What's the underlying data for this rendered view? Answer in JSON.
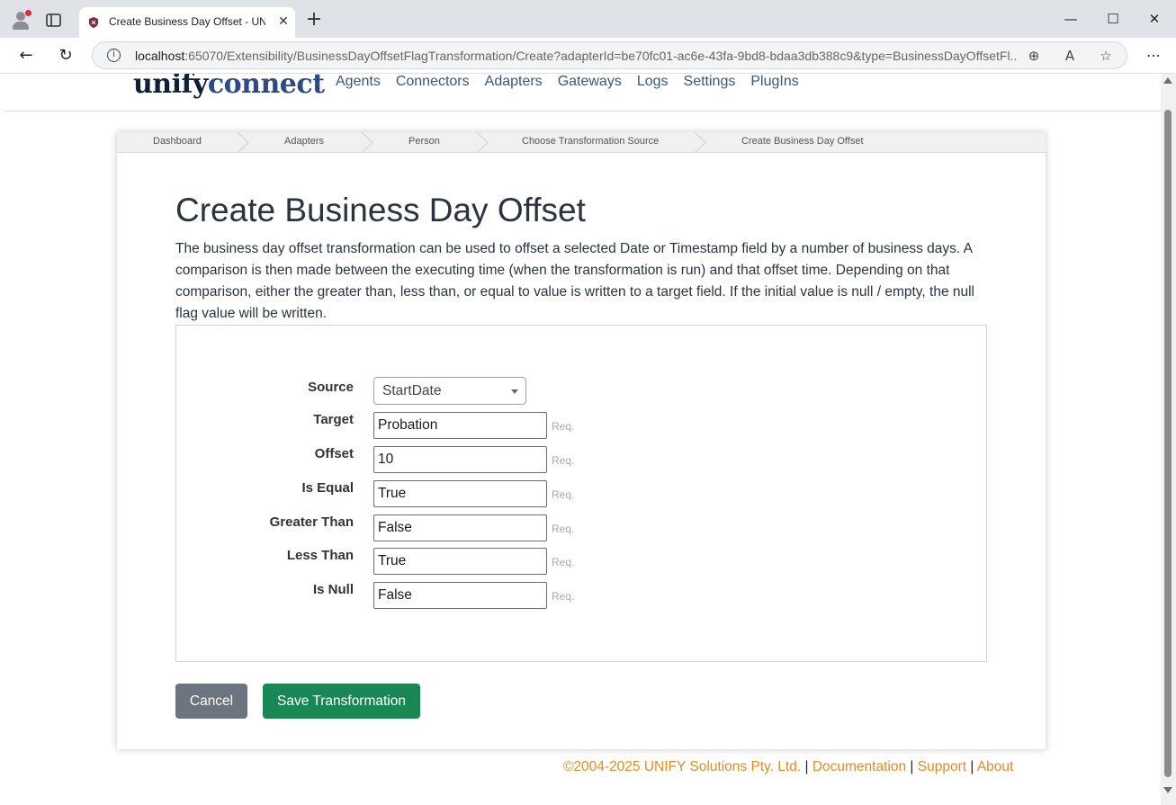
{
  "browser": {
    "tab_title": "Create Business Day Offset - UNIFY",
    "url_host": "localhost",
    "url_rest": ":65070/Extensibility/BusinessDayOffsetFlagTransformation/Create?adapterId=be70fc01-ac6e-43fa-9bd8-bdaa3db388c9&type=BusinessDayOffsetFl...",
    "controls": {
      "minimize": "—",
      "maximize": "☐",
      "close": "✕"
    }
  },
  "brand": {
    "part1": "unify",
    "part2": "connect"
  },
  "nav": {
    "links": [
      "Agents",
      "Connectors",
      "Adapters",
      "Gateways",
      "Logs",
      "Settings",
      "PlugIns"
    ]
  },
  "breadcrumb": {
    "items": [
      "Dashboard",
      "Adapters",
      "Person",
      "Choose Transformation Source",
      "Create Business Day Offset"
    ]
  },
  "page": {
    "title": "Create Business Day Offset",
    "description": "The business day offset transformation can be used to offset a selected Date or Timestamp field by a number of business days. A comparison is then made between the executing time (when the transformation is run) and that offset time. Depending on that comparison, either the greater than, less than, or equal to value is written to a target field. If the initial value is null / empty, the null flag value will be written."
  },
  "form": {
    "source": {
      "label": "Source",
      "value": "StartDate"
    },
    "req_label": "Req.",
    "fields": [
      {
        "label": "Target",
        "value": "Probation"
      },
      {
        "label": "Offset",
        "value": "10"
      },
      {
        "label": "Is Equal",
        "value": "True"
      },
      {
        "label": "Greater Than",
        "value": "False"
      },
      {
        "label": "Less Than",
        "value": "True"
      },
      {
        "label": "Is Null",
        "value": "False"
      }
    ]
  },
  "buttons": {
    "cancel": "Cancel",
    "save": "Save Transformation"
  },
  "footer": {
    "copyright": "©2004-2025 UNIFY Solutions Pty. Ltd.",
    "sep": "|",
    "documentation": "Documentation",
    "support": "Support",
    "about": "About"
  },
  "colors": {
    "cancel_button": "#6c757d",
    "save_button": "#198754",
    "footer_link": "#e38b24",
    "nav_link": "#3b5777"
  }
}
